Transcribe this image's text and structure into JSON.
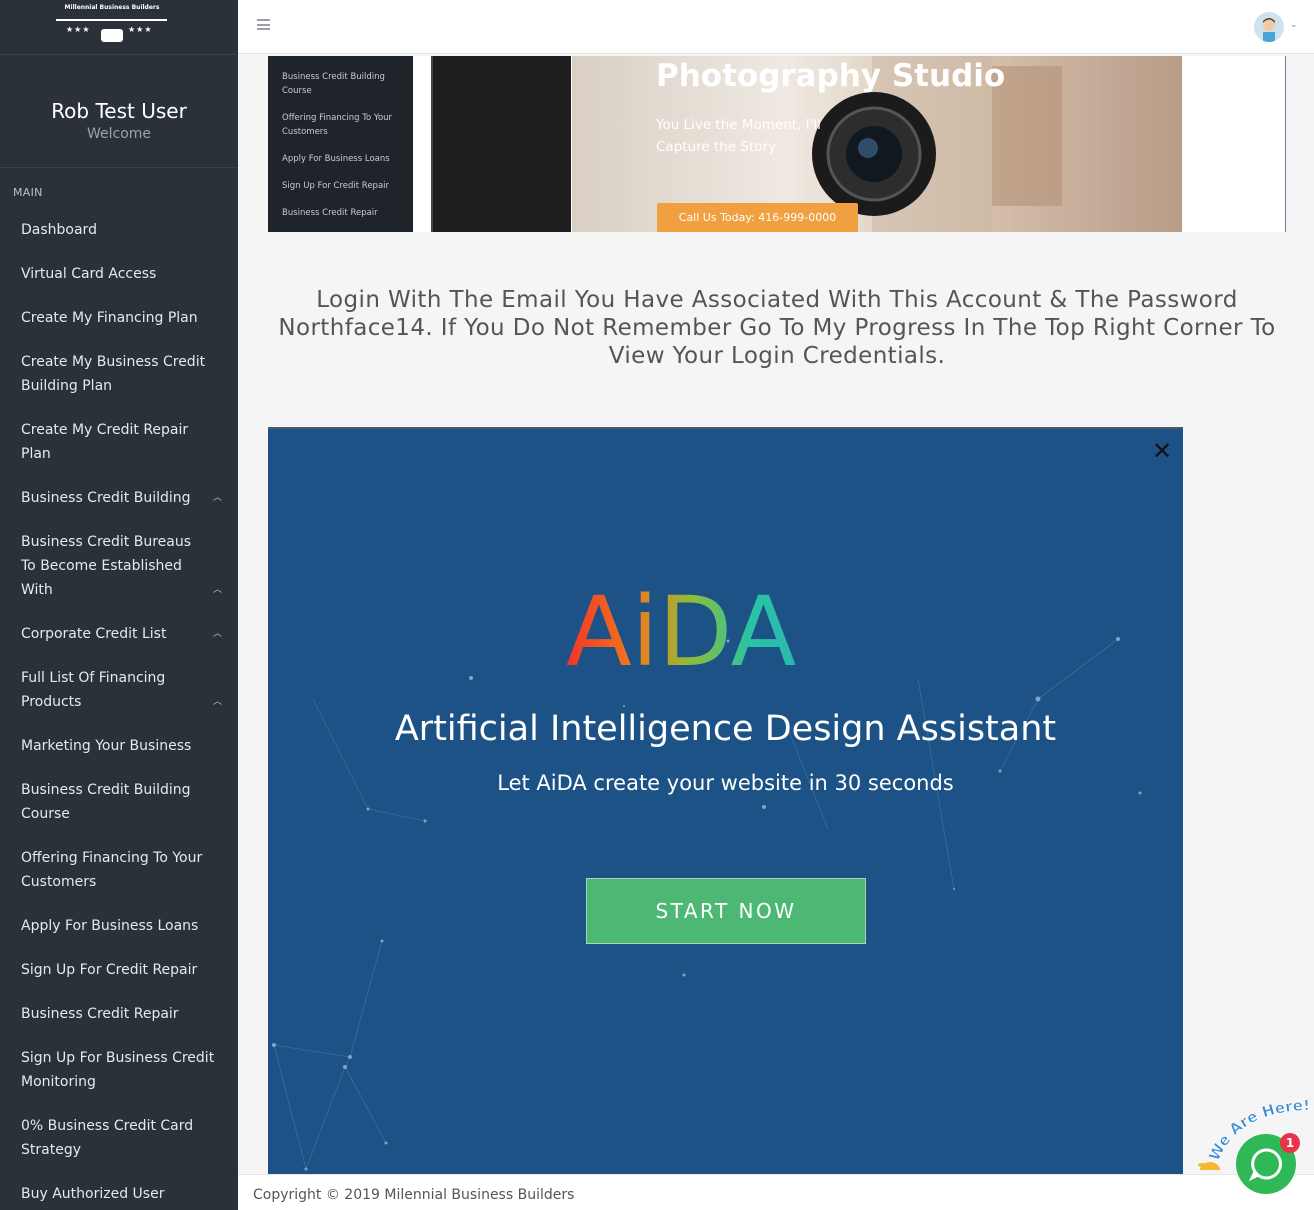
{
  "brand": {
    "logo_text": "Millennial Business Builders",
    "logo_stars": "★★★",
    "colors": {
      "sidebar": "#2b3139",
      "aida_bg": "#1c5285",
      "cta_green": "#4cb874",
      "chat_green": "#2fb856",
      "banner_cta": "#f0a040"
    }
  },
  "sidebar": {
    "user_name": "Rob Test User",
    "welcome": "Welcome",
    "section_label": "MAIN",
    "items": [
      {
        "label": "Dashboard",
        "chevron": ""
      },
      {
        "label": "Virtual Card Access",
        "chevron": ""
      },
      {
        "label": "Create My Financing Plan",
        "chevron": ""
      },
      {
        "label": "Create My Business Credit Building Plan",
        "chevron": ""
      },
      {
        "label": "Create My Credit Repair Plan",
        "chevron": ""
      },
      {
        "label": "Business Credit Building",
        "chevron": "^"
      },
      {
        "label": "Business Credit Bureaus To Become Established With",
        "chevron": "^"
      },
      {
        "label": "Corporate Credit List",
        "chevron": "^"
      },
      {
        "label": "Full List Of Financing Products",
        "chevron": "^"
      },
      {
        "label": "Marketing Your Business",
        "chevron": ""
      },
      {
        "label": "Business Credit Building Course",
        "chevron": ""
      },
      {
        "label": "Offering Financing To Your Customers",
        "chevron": ""
      },
      {
        "label": "Apply For Business Loans",
        "chevron": ""
      },
      {
        "label": "Sign Up For Credit Repair",
        "chevron": ""
      },
      {
        "label": "Business Credit Repair",
        "chevron": ""
      },
      {
        "label": "Sign Up For Business Credit Monitoring",
        "chevron": ""
      },
      {
        "label": "0% Business Credit Card Strategy",
        "chevron": ""
      },
      {
        "label": "Buy Authorized User Tradelines",
        "chevron": ""
      }
    ]
  },
  "topbar": {
    "menu_icon": "hamburger-icon",
    "avatar_icon": "user-avatar",
    "caret": "⌄"
  },
  "banner": {
    "mini_menu": [
      "Business Credit Building Course",
      "Offering Financing To Your Customers",
      "Apply For Business Loans",
      "Sign Up For Credit Repair",
      "Business Credit Repair"
    ],
    "title": "Photography Studio",
    "subtitle": "You Live the Moment, I'll Capture the Story",
    "cta": "Call Us Today: 416-999-0000"
  },
  "login_message": "Login With The Email You Have Associated With This Account & The Password Northface14. If You Do Not Remember Go To My Progress In The Top Right Corner To View Your Login Credentials.",
  "aida": {
    "close": "✕",
    "logo": "AiDA",
    "title": "Artificial Intelligence Design Assistant",
    "subtitle": "Let AiDA create your website in 30 seconds",
    "button": "START NOW"
  },
  "footer": {
    "copyright": "Copyright © 2019 Milennial Business Builders"
  },
  "chat": {
    "tagline": "We Are Here!",
    "badge": "1"
  }
}
